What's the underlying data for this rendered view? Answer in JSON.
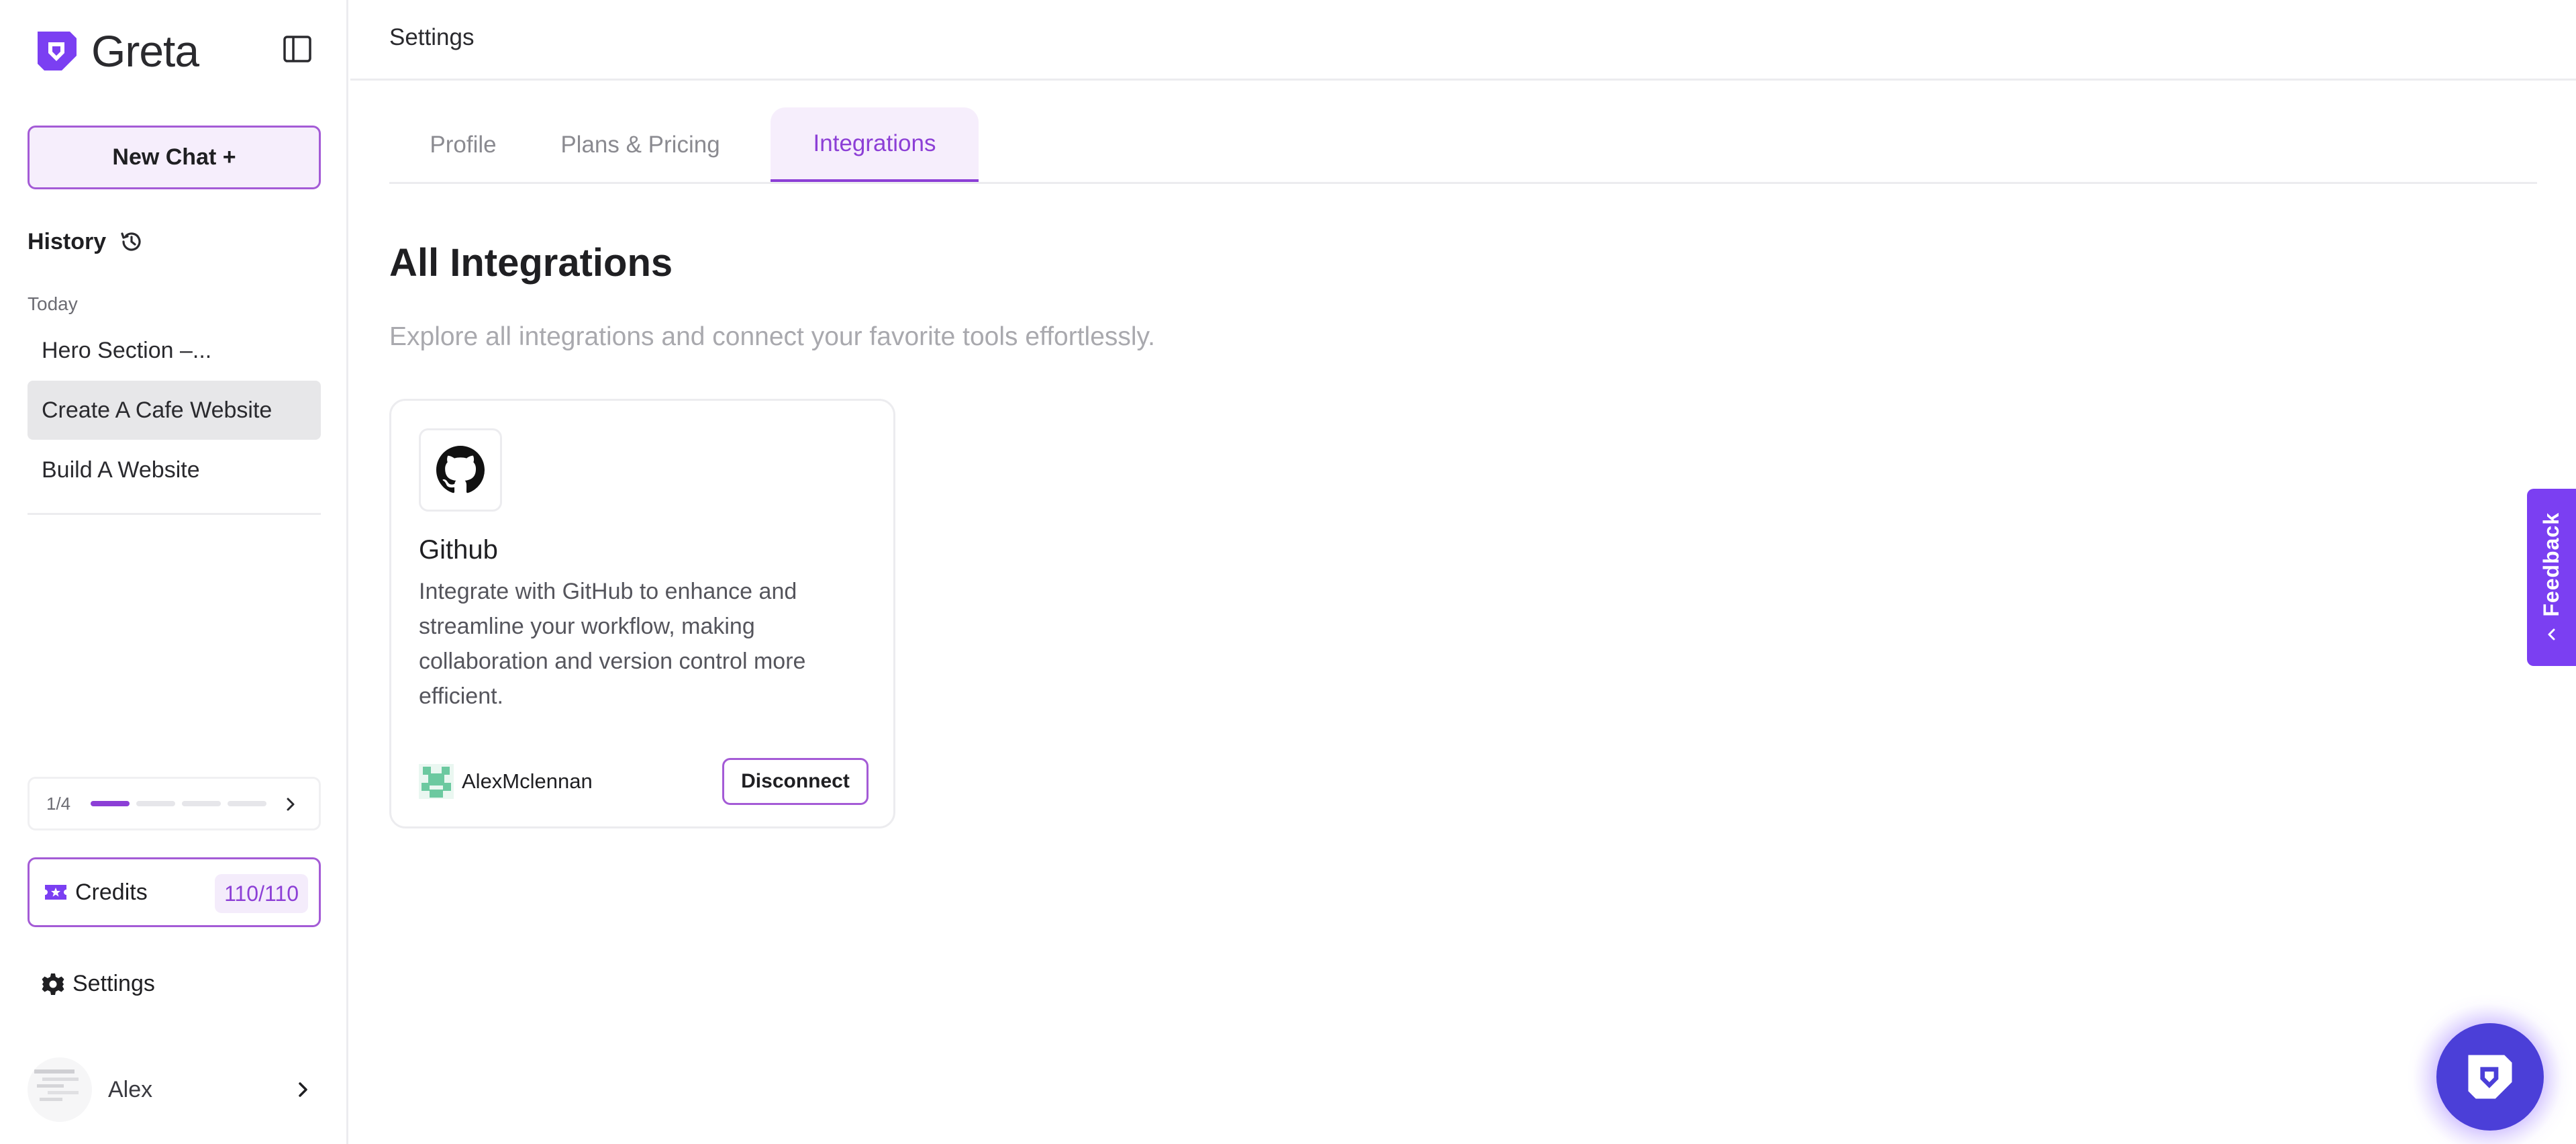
{
  "app": {
    "name": "Greta"
  },
  "sidebar": {
    "new_chat_label": "New Chat +",
    "history_label": "History",
    "today_label": "Today",
    "history_items": [
      {
        "label": "Hero Section –...",
        "active": false
      },
      {
        "label": "Create A Cafe Website",
        "active": true
      },
      {
        "label": "Build A Website",
        "active": false
      }
    ],
    "progress": {
      "text": "1/4",
      "current": 1,
      "total": 4
    },
    "credits": {
      "label": "Credits",
      "count": "110/110"
    },
    "settings_label": "Settings",
    "user": {
      "name": "Alex"
    }
  },
  "header": {
    "title": "Settings"
  },
  "tabs": [
    {
      "label": "Profile",
      "active": false
    },
    {
      "label": "Plans & Pricing",
      "active": false
    },
    {
      "label": "Integrations",
      "active": true
    }
  ],
  "main": {
    "title": "All Integrations",
    "subtitle": "Explore all integrations and connect your favorite tools effortlessly.",
    "integrations": [
      {
        "name": "Github",
        "icon": "github-icon",
        "description": "Integrate with GitHub to enhance and streamline your workflow, making collaboration and version control more efficient.",
        "account": "AlexMclennan",
        "action_label": "Disconnect"
      }
    ]
  },
  "feedback_label": "Feedback",
  "colors": {
    "accent": "#8c3fd6",
    "accent_light": "#f6eefc",
    "feedback_bg": "#7b3ff2",
    "launcher_bg": "#4b3fd8"
  }
}
